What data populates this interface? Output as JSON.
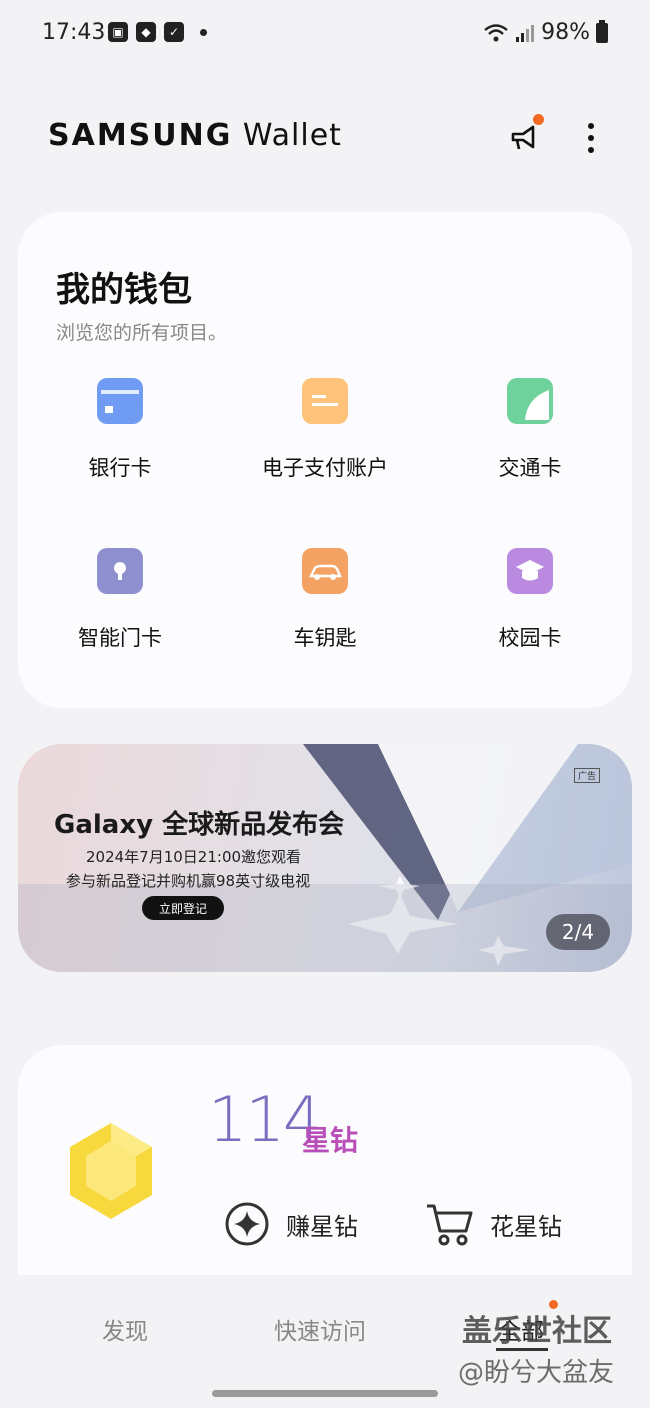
{
  "status_bar": {
    "time": "17:43",
    "battery": "98%"
  },
  "header": {
    "brand_bold": "SAMSUNG",
    "brand_light": " Wallet"
  },
  "wallet": {
    "title": "我的钱包",
    "subtitle": "浏览您的所有项目。",
    "items": [
      {
        "label": "银行卡",
        "icon": "bank-card-icon",
        "color": "#6f9bf2"
      },
      {
        "label": "电子支付账户",
        "icon": "e-payment-icon",
        "color": "#ffc27a"
      },
      {
        "label": "交通卡",
        "icon": "transit-card-icon",
        "color": "#6fd19b"
      },
      {
        "label": "智能门卡",
        "icon": "smart-key-icon",
        "color": "#8e8fcf"
      },
      {
        "label": "车钥匙",
        "icon": "car-key-icon",
        "color": "#f4a263"
      },
      {
        "label": "校园卡",
        "icon": "campus-card-icon",
        "color": "#b98ae0"
      }
    ]
  },
  "banner": {
    "title": "Galaxy 全球新品发布会",
    "line1": "2024年7月10日21:00邀您观看",
    "line2": "参与新品登记并购机赢98英寸级电视",
    "button": "立即登记",
    "ad_tag": "广告",
    "pager": "2/4"
  },
  "points": {
    "value": "114",
    "unit": "星钻",
    "earn_label": "赚星钻",
    "spend_label": "花星钻"
  },
  "nav": {
    "tabs": [
      "发现",
      "快速访问",
      "全部"
    ],
    "watermark_line1": "盖乐世社区",
    "watermark_line2": "@盼兮大盆友"
  }
}
